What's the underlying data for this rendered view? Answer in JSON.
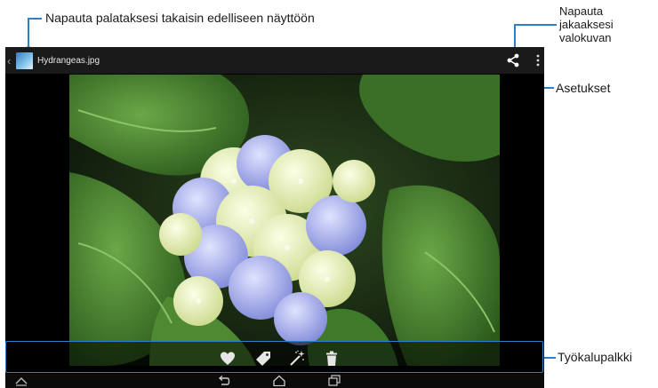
{
  "callouts": {
    "back": "Napauta palataksesi takaisin edelliseen näyttöön",
    "share_line1": "Napauta",
    "share_line2": "jakaaksesi",
    "share_line3": "valokuvan",
    "settings": "Asetukset",
    "toolbar": "Työkalupalkki"
  },
  "app": {
    "file_name": "Hydrangeas.jpg",
    "back_icon": "chevron-left-icon",
    "thumb_icon": "gallery-thumbnail-icon"
  },
  "toolbar_icons": [
    "heart-icon",
    "tag-icon",
    "magic-wand-icon",
    "trash-icon"
  ],
  "nav_icons": [
    "hide-bar-icon",
    "back-icon",
    "home-icon",
    "recent-apps-icon"
  ],
  "colors": {
    "accent": "#2d7fc8",
    "bar": "#1a1a1a"
  }
}
